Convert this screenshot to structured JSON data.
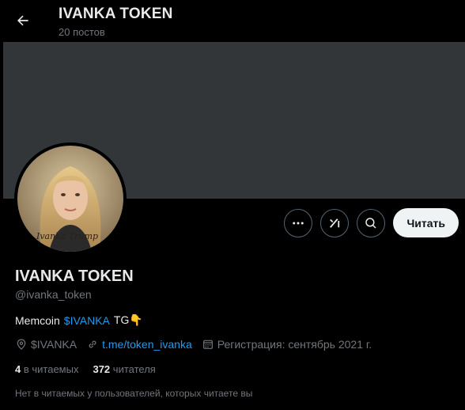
{
  "header": {
    "title": "IVANKA TOKEN",
    "posts_count": "20 постов"
  },
  "avatar": {
    "caption": "Ivanka Trump"
  },
  "actions": {
    "more_icon": "more-dots-icon",
    "grok_icon": "grok-icon",
    "search_icon": "search-icon",
    "follow_label": "Читать"
  },
  "profile": {
    "name": "IVANKA TOKEN",
    "handle": "@ivanka_token",
    "bio_prefix": "Memcoin",
    "bio_link": "$IVANKA",
    "bio_suffix": "TG👇",
    "location": "$IVANKA",
    "website": "t.me/token_ivanka",
    "joined": "Регистрация: сентябрь 2021 г."
  },
  "stats": {
    "following_count": "4",
    "following_label": "в читаемых",
    "followers_count": "372",
    "followers_label": "читателя"
  },
  "followers_note": "Нет в читаемых у пользователей, которых читаете вы",
  "colors": {
    "accent": "#1d9bf0",
    "banner": "#333639",
    "muted": "#71767b",
    "follow_bg": "#eff3f4"
  }
}
